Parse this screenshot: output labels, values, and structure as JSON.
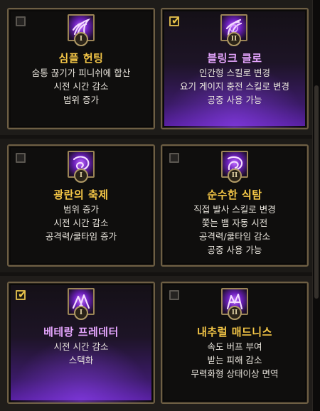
{
  "cards": [
    {
      "title": "심플 헌팅",
      "tier": "I",
      "checked": false,
      "icon": "claw-tier1-icon",
      "desc": [
        "숨통 끊기가 피니쉬에 합산",
        "시전 시간 감소",
        "범위 증가"
      ]
    },
    {
      "title": "블링크 클로",
      "tier": "II",
      "checked": true,
      "icon": "claw-tier2-icon",
      "desc": [
        "인간형 스킬로 변경",
        "요기 게이지 충전 스킬로 변경",
        "공중 사용 가능"
      ]
    },
    {
      "title": "광란의 축제",
      "tier": "I",
      "checked": false,
      "icon": "frenzy-tier1-icon",
      "desc": [
        "범위 증가",
        "시전 시간 감소",
        "공격력/쿨타임 증가"
      ]
    },
    {
      "title": "순수한 식탐",
      "tier": "II",
      "checked": false,
      "icon": "frenzy-tier2-icon",
      "desc": [
        "직접 발사 스킬로 변경",
        "쫓는 뱀 자동 시전",
        "공격력/쿨타임 감소",
        "공중 사용 가능"
      ]
    },
    {
      "title": "베테랑 프레데터",
      "tier": "I",
      "checked": true,
      "icon": "predator-tier1-icon",
      "desc": [
        "시전 시간 감소",
        "스택화"
      ]
    },
    {
      "title": "내추럴 매드니스",
      "tier": "II",
      "checked": false,
      "icon": "predator-tier2-icon",
      "desc": [
        "속도 버프 부여",
        "받는 피해 감소",
        "무력화형 상태이상 면역"
      ]
    }
  ],
  "colors": {
    "title_gold": "#f5c747",
    "title_selected": "#e6a6ff",
    "desc": "#e8e4dc",
    "frame": "#6e5f44",
    "glow": "#5b21a8"
  }
}
